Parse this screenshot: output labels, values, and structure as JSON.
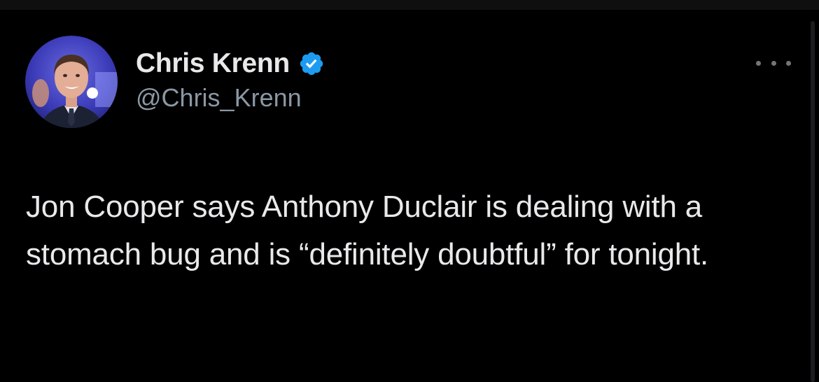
{
  "author": {
    "display_name": "Chris Krenn",
    "handle": "@Chris_Krenn",
    "verified": true,
    "verified_color": "#1d9bf0"
  },
  "tweet": {
    "text": "Jon Cooper says Anthony Duclair is dealing with a stomach bug and is “definitely doubtful” for tonight."
  },
  "icons": {
    "more": "more-horizontal-icon",
    "verified": "verified-badge-icon",
    "avatar": "avatar"
  },
  "colors": {
    "background": "#000000",
    "text_primary": "#e7e9ea",
    "text_secondary": "#8b98a5"
  }
}
